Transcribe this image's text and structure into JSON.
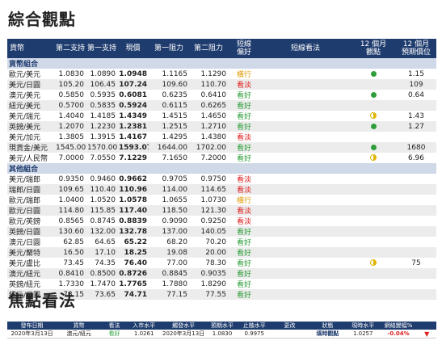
{
  "title": "綜合觀點",
  "focus_title": "焦點看法",
  "main_table": {
    "headers": [
      "貨幣",
      "第二支持",
      "第一支持",
      "現價",
      "第一阻力",
      "第二阻力",
      "短線\n偏好",
      "短線看法",
      "12 個月\n觀點",
      "12 個月\n預期價位"
    ],
    "sections": [
      {
        "name": "貨幣組合",
        "rows": [
          {
            "name": "歐元/美元",
            "s2": "1.0830",
            "s1": "1.0890",
            "price": "1.0948",
            "r1": "1.1165",
            "r2": "1.1290",
            "pref": "橫行",
            "pref_class": "neu",
            "view": "",
            "view12": "full",
            "target": "1.15"
          },
          {
            "name": "美元/日圓",
            "s2": "105.20",
            "s1": "106.45",
            "price": "107.24",
            "r1": "109.60",
            "r2": "110.70",
            "pref": "看淡",
            "pref_class": "neg",
            "view": "",
            "view12": "",
            "target": "109"
          },
          {
            "name": "澳元/美元",
            "s2": "0.5850",
            "s1": "0.5935",
            "price": "0.6081",
            "r1": "0.6235",
            "r2": "0.6410",
            "pref": "看好",
            "pref_class": "pos",
            "view": "",
            "view12": "full",
            "target": "0.64"
          },
          {
            "name": "紐元/美元",
            "s2": "0.5700",
            "s1": "0.5835",
            "price": "0.5924",
            "r1": "0.6115",
            "r2": "0.6265",
            "pref": "看好",
            "pref_class": "pos",
            "view": "",
            "view12": "",
            "target": ""
          },
          {
            "name": "美元/瑞元",
            "s2": "1.4040",
            "s1": "1.4185",
            "price": "1.4349",
            "r1": "1.4515",
            "r2": "1.4650",
            "pref": "看好",
            "pref_class": "pos",
            "view": "",
            "view12": "half",
            "target": "1.43"
          },
          {
            "name": "英鎊/美元",
            "s2": "1.2070",
            "s1": "1.2230",
            "price": "1.2381",
            "r1": "1.2515",
            "r2": "1.2710",
            "pref": "看好",
            "pref_class": "pos",
            "view": "",
            "view12": "full",
            "target": "1.27"
          },
          {
            "name": "美元/加元",
            "s2": "1.3805",
            "s1": "1.3915",
            "price": "1.4167",
            "r1": "1.4295",
            "r2": "1.4380",
            "pref": "看淡",
            "pref_class": "neg",
            "view": "",
            "view12": "",
            "target": ""
          },
          {
            "name": "現貨金/美元",
            "s2": "1545.00",
            "s1": "1570.00",
            "price": "1593.07",
            "r1": "1644.00",
            "r2": "1702.00",
            "pref": "看好",
            "pref_class": "pos",
            "view": "",
            "view12": "full",
            "target": "1680"
          },
          {
            "name": "美元/人民幣",
            "s2": "7.0000",
            "s1": "7.0550",
            "price": "7.1229",
            "r1": "7.1650",
            "r2": "7.2000",
            "pref": "看好",
            "pref_class": "pos",
            "view": "",
            "view12": "half",
            "target": "6.96"
          }
        ]
      },
      {
        "name": "其他組合",
        "rows": [
          {
            "name": "美元/瑞郎",
            "s2": "0.9350",
            "s1": "0.9460",
            "price": "0.9662",
            "r1": "0.9705",
            "r2": "0.9750",
            "pref": "看淡",
            "pref_class": "neg",
            "view": "",
            "view12": "",
            "target": ""
          },
          {
            "name": "瑞郎/日圓",
            "s2": "109.65",
            "s1": "110.40",
            "price": "110.96",
            "r1": "114.00",
            "r2": "114.65",
            "pref": "看淡",
            "pref_class": "neg",
            "view": "",
            "view12": "",
            "target": ""
          },
          {
            "name": "歐元/瑞郎",
            "s2": "1.0400",
            "s1": "1.0520",
            "price": "1.0578",
            "r1": "1.0655",
            "r2": "1.0730",
            "pref": "橫行",
            "pref_class": "neu",
            "view": "",
            "view12": "",
            "target": ""
          },
          {
            "name": "歐元/日圓",
            "s2": "114.80",
            "s1": "115.85",
            "price": "117.40",
            "r1": "118.50",
            "r2": "121.30",
            "pref": "看淡",
            "pref_class": "neg",
            "view": "",
            "view12": "",
            "target": ""
          },
          {
            "name": "歐元/英鎊",
            "s2": "0.8565",
            "s1": "0.8745",
            "price": "0.8839",
            "r1": "0.9090",
            "r2": "0.9250",
            "pref": "看淡",
            "pref_class": "neg",
            "view": "",
            "view12": "",
            "target": ""
          },
          {
            "name": "英鎊/日圓",
            "s2": "130.60",
            "s1": "132.00",
            "price": "132.78",
            "r1": "137.00",
            "r2": "140.05",
            "pref": "看好",
            "pref_class": "pos",
            "view": "",
            "view12": "",
            "target": ""
          },
          {
            "name": "澳元/日圓",
            "s2": "62.85",
            "s1": "64.65",
            "price": "65.22",
            "r1": "68.20",
            "r2": "70.20",
            "pref": "看好",
            "pref_class": "pos",
            "view": "",
            "view12": "",
            "target": ""
          },
          {
            "name": "美元/蘭特",
            "s2": "16.50",
            "s1": "17.10",
            "price": "18.25",
            "r1": "19.08",
            "r2": "20.00",
            "pref": "看好",
            "pref_class": "pos",
            "view": "",
            "view12": "",
            "target": ""
          },
          {
            "name": "美元/盧比",
            "s2": "73.45",
            "s1": "74.35",
            "price": "76.40",
            "r1": "77.00",
            "r2": "78.30",
            "pref": "看好",
            "pref_class": "pos",
            "view": "",
            "view12": "half",
            "target": "75"
          },
          {
            "name": "澳元/紐元",
            "s2": "0.8410",
            "s1": "0.8500",
            "price": "0.8726",
            "r1": "0.8845",
            "r2": "0.9035",
            "pref": "看好",
            "pref_class": "pos",
            "view": "",
            "view12": "",
            "target": ""
          },
          {
            "name": "英鎊/紐元",
            "s2": "1.7330",
            "s1": "1.7470",
            "price": "1.7765",
            "r1": "1.7880",
            "r2": "1.8290",
            "pref": "看好",
            "pref_class": "pos",
            "view": "",
            "view12": "",
            "target": ""
          },
          {
            "name": "紐元/日圓",
            "s2": "73.15",
            "s1": "73.65",
            "price": "74.71",
            "r1": "77.15",
            "r2": "77.55",
            "pref": "看好",
            "pref_class": "pos",
            "view": "",
            "view12": "",
            "target": ""
          }
        ]
      }
    ]
  },
  "focus_table": {
    "headers": [
      "發布日期",
      "貨幣",
      "看法",
      "入市水平",
      "觸發水平",
      "預期水平",
      "止蝕水平",
      "更改",
      "狀態",
      "現時水平",
      "網絡變幅%",
      ""
    ],
    "rows": [
      {
        "date": "2020年3月13日",
        "pair": "澳元/紐元",
        "view": "看好",
        "entry": "1.0261",
        "trigger": "2020年3月13日",
        "target": "1.0830",
        "stop": "0.9975",
        "change": "",
        "status": "填時觀點",
        "current": "1.0257",
        "pct": "-0.04%",
        "arrow": "▼"
      }
    ]
  },
  "colors": {
    "header_bg": "#1f3c6e",
    "section_bg": "#d0d9e8",
    "pos": "#2e9e3a",
    "neg": "#e02020",
    "neu": "#e09a00"
  }
}
